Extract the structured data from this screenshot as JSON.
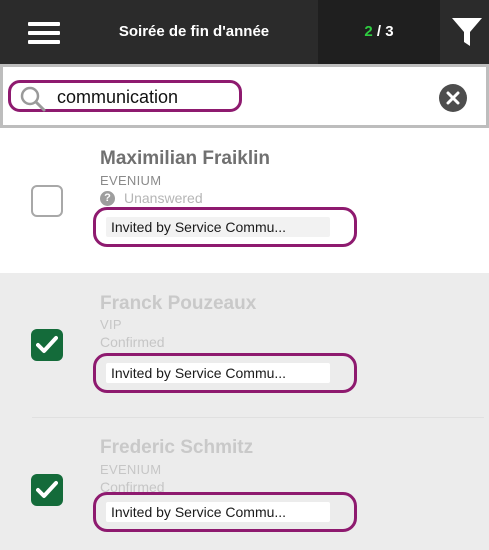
{
  "header": {
    "title": "Soirée de fin d'année",
    "counter_current": "2",
    "counter_separator": " / ",
    "counter_total": "3",
    "accent_color": "#2ecc40"
  },
  "search": {
    "value": "communication"
  },
  "guests": [
    {
      "name": "Maximilian Fraiklin",
      "company": "EVENIUM",
      "status": "Unanswered",
      "status_icon": "question-circle-icon",
      "checked": false,
      "tag": "Invited by Service Commu..."
    },
    {
      "name": "Franck Pouzeaux",
      "company": "VIP",
      "status": "Confirmed",
      "checked": true,
      "tag": "Invited by Service Commu..."
    },
    {
      "name": "Frederic Schmitz",
      "company": "EVENIUM",
      "status": "Confirmed",
      "checked": true,
      "tag": "Invited by Service Commu..."
    }
  ],
  "colors": {
    "header_bg": "#2b2b2b",
    "checkbox_checked": "#146b3a",
    "highlight_outline": "#8e1a6f"
  }
}
